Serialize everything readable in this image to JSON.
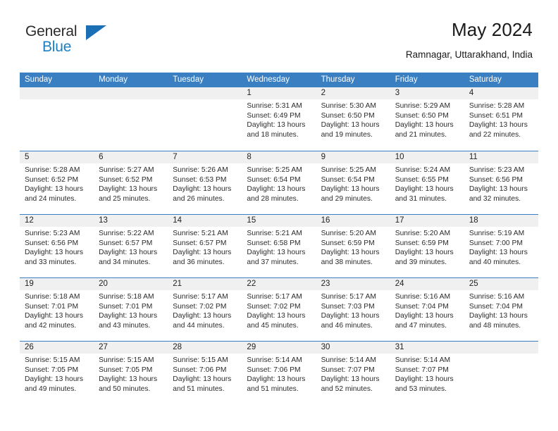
{
  "brand": {
    "name_part1": "General",
    "name_part2": "Blue",
    "triangle_color": "#1a6fb5"
  },
  "header": {
    "title": "May 2024",
    "subtitle": "Ramnagar, Uttarakhand, India"
  },
  "colors": {
    "header_blue": "#3a7fc1",
    "day_band_gray": "#f0f0f0",
    "text_dark": "#2b2b2b",
    "brand_blue": "#1c7fc4"
  },
  "calendar": {
    "weekdays": [
      "Sunday",
      "Monday",
      "Tuesday",
      "Wednesday",
      "Thursday",
      "Friday",
      "Saturday"
    ],
    "weeks": [
      [
        {
          "day": "",
          "lines": []
        },
        {
          "day": "",
          "lines": []
        },
        {
          "day": "",
          "lines": []
        },
        {
          "day": "1",
          "lines": [
            "Sunrise: 5:31 AM",
            "Sunset: 6:49 PM",
            "Daylight: 13 hours",
            "and 18 minutes."
          ]
        },
        {
          "day": "2",
          "lines": [
            "Sunrise: 5:30 AM",
            "Sunset: 6:50 PM",
            "Daylight: 13 hours",
            "and 19 minutes."
          ]
        },
        {
          "day": "3",
          "lines": [
            "Sunrise: 5:29 AM",
            "Sunset: 6:50 PM",
            "Daylight: 13 hours",
            "and 21 minutes."
          ]
        },
        {
          "day": "4",
          "lines": [
            "Sunrise: 5:28 AM",
            "Sunset: 6:51 PM",
            "Daylight: 13 hours",
            "and 22 minutes."
          ]
        }
      ],
      [
        {
          "day": "5",
          "lines": [
            "Sunrise: 5:28 AM",
            "Sunset: 6:52 PM",
            "Daylight: 13 hours",
            "and 24 minutes."
          ]
        },
        {
          "day": "6",
          "lines": [
            "Sunrise: 5:27 AM",
            "Sunset: 6:52 PM",
            "Daylight: 13 hours",
            "and 25 minutes."
          ]
        },
        {
          "day": "7",
          "lines": [
            "Sunrise: 5:26 AM",
            "Sunset: 6:53 PM",
            "Daylight: 13 hours",
            "and 26 minutes."
          ]
        },
        {
          "day": "8",
          "lines": [
            "Sunrise: 5:25 AM",
            "Sunset: 6:54 PM",
            "Daylight: 13 hours",
            "and 28 minutes."
          ]
        },
        {
          "day": "9",
          "lines": [
            "Sunrise: 5:25 AM",
            "Sunset: 6:54 PM",
            "Daylight: 13 hours",
            "and 29 minutes."
          ]
        },
        {
          "day": "10",
          "lines": [
            "Sunrise: 5:24 AM",
            "Sunset: 6:55 PM",
            "Daylight: 13 hours",
            "and 31 minutes."
          ]
        },
        {
          "day": "11",
          "lines": [
            "Sunrise: 5:23 AM",
            "Sunset: 6:56 PM",
            "Daylight: 13 hours",
            "and 32 minutes."
          ]
        }
      ],
      [
        {
          "day": "12",
          "lines": [
            "Sunrise: 5:23 AM",
            "Sunset: 6:56 PM",
            "Daylight: 13 hours",
            "and 33 minutes."
          ]
        },
        {
          "day": "13",
          "lines": [
            "Sunrise: 5:22 AM",
            "Sunset: 6:57 PM",
            "Daylight: 13 hours",
            "and 34 minutes."
          ]
        },
        {
          "day": "14",
          "lines": [
            "Sunrise: 5:21 AM",
            "Sunset: 6:57 PM",
            "Daylight: 13 hours",
            "and 36 minutes."
          ]
        },
        {
          "day": "15",
          "lines": [
            "Sunrise: 5:21 AM",
            "Sunset: 6:58 PM",
            "Daylight: 13 hours",
            "and 37 minutes."
          ]
        },
        {
          "day": "16",
          "lines": [
            "Sunrise: 5:20 AM",
            "Sunset: 6:59 PM",
            "Daylight: 13 hours",
            "and 38 minutes."
          ]
        },
        {
          "day": "17",
          "lines": [
            "Sunrise: 5:20 AM",
            "Sunset: 6:59 PM",
            "Daylight: 13 hours",
            "and 39 minutes."
          ]
        },
        {
          "day": "18",
          "lines": [
            "Sunrise: 5:19 AM",
            "Sunset: 7:00 PM",
            "Daylight: 13 hours",
            "and 40 minutes."
          ]
        }
      ],
      [
        {
          "day": "19",
          "lines": [
            "Sunrise: 5:18 AM",
            "Sunset: 7:01 PM",
            "Daylight: 13 hours",
            "and 42 minutes."
          ]
        },
        {
          "day": "20",
          "lines": [
            "Sunrise: 5:18 AM",
            "Sunset: 7:01 PM",
            "Daylight: 13 hours",
            "and 43 minutes."
          ]
        },
        {
          "day": "21",
          "lines": [
            "Sunrise: 5:17 AM",
            "Sunset: 7:02 PM",
            "Daylight: 13 hours",
            "and 44 minutes."
          ]
        },
        {
          "day": "22",
          "lines": [
            "Sunrise: 5:17 AM",
            "Sunset: 7:02 PM",
            "Daylight: 13 hours",
            "and 45 minutes."
          ]
        },
        {
          "day": "23",
          "lines": [
            "Sunrise: 5:17 AM",
            "Sunset: 7:03 PM",
            "Daylight: 13 hours",
            "and 46 minutes."
          ]
        },
        {
          "day": "24",
          "lines": [
            "Sunrise: 5:16 AM",
            "Sunset: 7:04 PM",
            "Daylight: 13 hours",
            "and 47 minutes."
          ]
        },
        {
          "day": "25",
          "lines": [
            "Sunrise: 5:16 AM",
            "Sunset: 7:04 PM",
            "Daylight: 13 hours",
            "and 48 minutes."
          ]
        }
      ],
      [
        {
          "day": "26",
          "lines": [
            "Sunrise: 5:15 AM",
            "Sunset: 7:05 PM",
            "Daylight: 13 hours",
            "and 49 minutes."
          ]
        },
        {
          "day": "27",
          "lines": [
            "Sunrise: 5:15 AM",
            "Sunset: 7:05 PM",
            "Daylight: 13 hours",
            "and 50 minutes."
          ]
        },
        {
          "day": "28",
          "lines": [
            "Sunrise: 5:15 AM",
            "Sunset: 7:06 PM",
            "Daylight: 13 hours",
            "and 51 minutes."
          ]
        },
        {
          "day": "29",
          "lines": [
            "Sunrise: 5:14 AM",
            "Sunset: 7:06 PM",
            "Daylight: 13 hours",
            "and 51 minutes."
          ]
        },
        {
          "day": "30",
          "lines": [
            "Sunrise: 5:14 AM",
            "Sunset: 7:07 PM",
            "Daylight: 13 hours",
            "and 52 minutes."
          ]
        },
        {
          "day": "31",
          "lines": [
            "Sunrise: 5:14 AM",
            "Sunset: 7:07 PM",
            "Daylight: 13 hours",
            "and 53 minutes."
          ]
        },
        {
          "day": "",
          "lines": []
        }
      ]
    ]
  }
}
